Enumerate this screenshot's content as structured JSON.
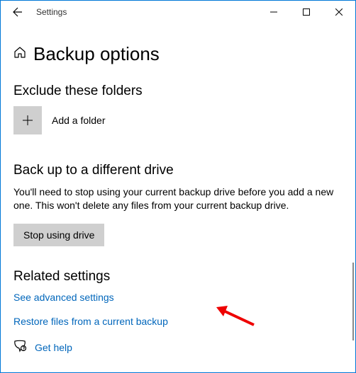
{
  "titlebar": {
    "app_title": "Settings"
  },
  "page": {
    "title": "Backup options"
  },
  "exclude": {
    "heading": "Exclude these folders",
    "add_label": "Add a folder"
  },
  "different_drive": {
    "heading": "Back up to a different drive",
    "description": "You'll need to stop using your current backup drive before you add a new one. This won't delete any files from your current backup drive.",
    "button": "Stop using drive"
  },
  "related": {
    "heading": "Related settings",
    "advanced_link": "See advanced settings",
    "restore_link": "Restore files from a current backup"
  },
  "help": {
    "label": "Get help"
  }
}
